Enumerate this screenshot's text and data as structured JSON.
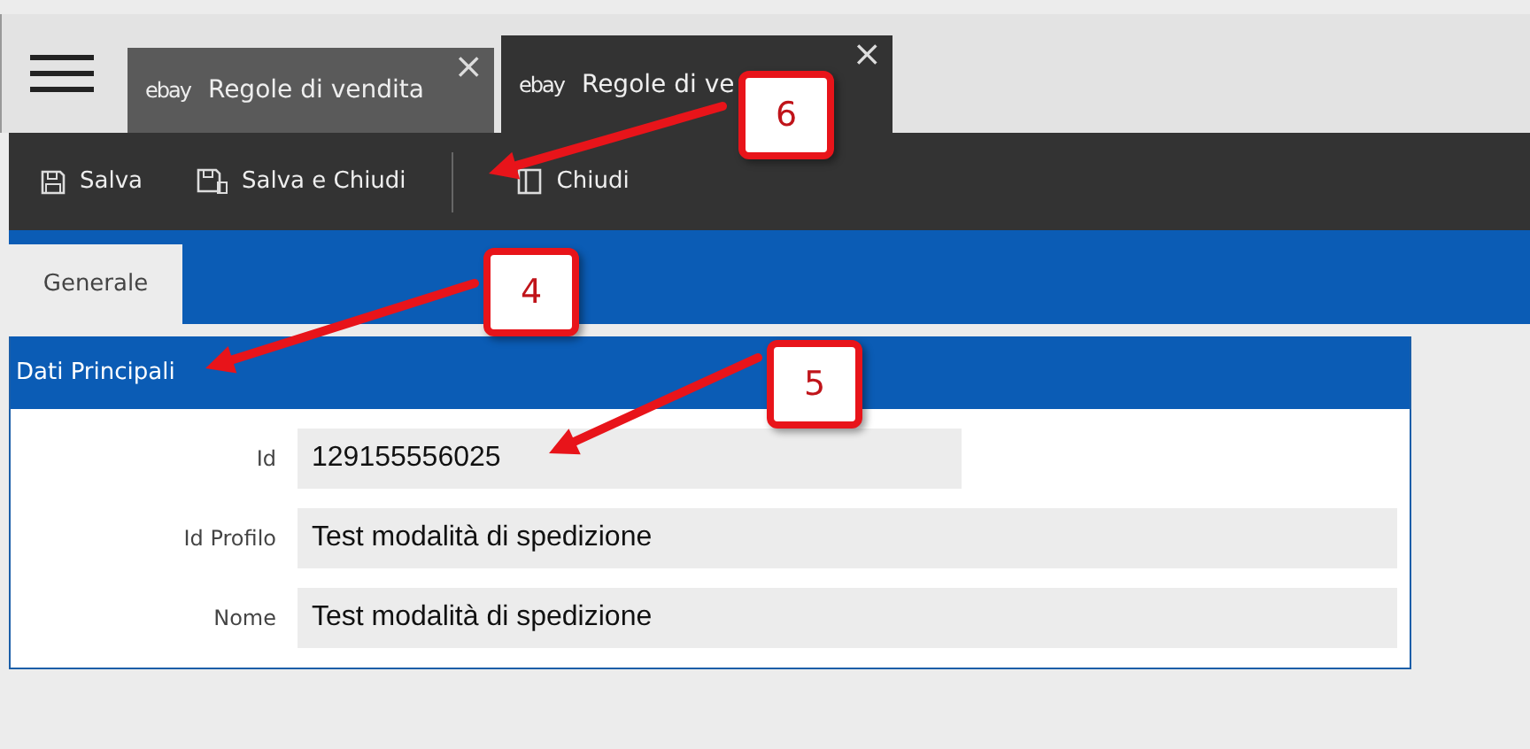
{
  "tabs": [
    {
      "logo": "ebay",
      "label": "Regole di vendita",
      "close": "×",
      "selected": false
    },
    {
      "logo": "ebay",
      "label": "Regole di ve",
      "close": "×",
      "selected": true
    }
  ],
  "toolbar": [
    {
      "kind": "save",
      "label": "Salva"
    },
    {
      "kind": "saveclose",
      "label": "Salva e Chiudi"
    },
    {
      "kind": "close",
      "label": "Chiudi"
    }
  ],
  "section_tabs": [
    {
      "label": "Generale",
      "selected": true
    }
  ],
  "panel": {
    "title": "Dati Principali",
    "fields": [
      {
        "label": "Id",
        "value": "129155556025",
        "wide": false
      },
      {
        "label": "Id Profilo",
        "value": "Test modalità di spedizione",
        "wide": true
      },
      {
        "label": "Nome",
        "value": "Test modalità di spedizione",
        "wide": true
      }
    ]
  },
  "callouts": [
    {
      "number": "6"
    },
    {
      "number": "4"
    },
    {
      "number": "5"
    }
  ]
}
